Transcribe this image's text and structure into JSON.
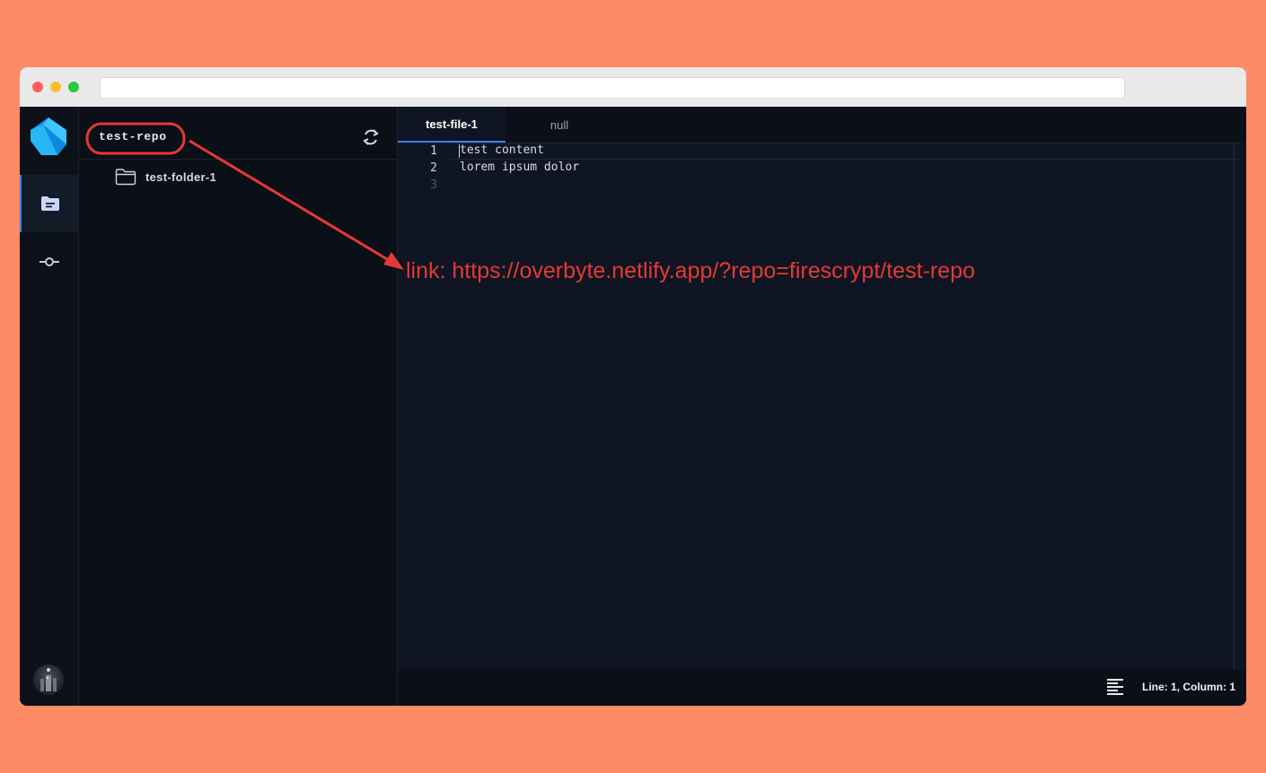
{
  "explorer": {
    "repo_name": "test-repo",
    "tree": [
      {
        "type": "folder",
        "label": "test-folder-1"
      }
    ]
  },
  "editor": {
    "tabs": [
      {
        "label": "test-file-1",
        "active": true
      },
      {
        "label": "null",
        "active": false
      }
    ],
    "lines": [
      {
        "num": "1",
        "text": "test content"
      },
      {
        "num": "2",
        "text": "lorem ipsum dolor"
      },
      {
        "num": "3",
        "text": ""
      }
    ]
  },
  "statusbar": {
    "position": "Line: 1, Column: 1"
  },
  "annotation": {
    "text": "link: https://overbyte.netlify.app/?repo=firescrypt/test-repo",
    "color": "#e53935"
  },
  "icons": {
    "logo": "dart-logo-icon",
    "files": "file-explorer-icon",
    "commits": "git-commit-icon",
    "refresh": "refresh-icon",
    "folder": "folder-icon",
    "format": "align-lines-icon"
  },
  "colors": {
    "background": "#ff8a66",
    "accent": "#3b82f6",
    "editor_bg": "#0f1523",
    "sidebar_bg": "#0b0f17"
  }
}
